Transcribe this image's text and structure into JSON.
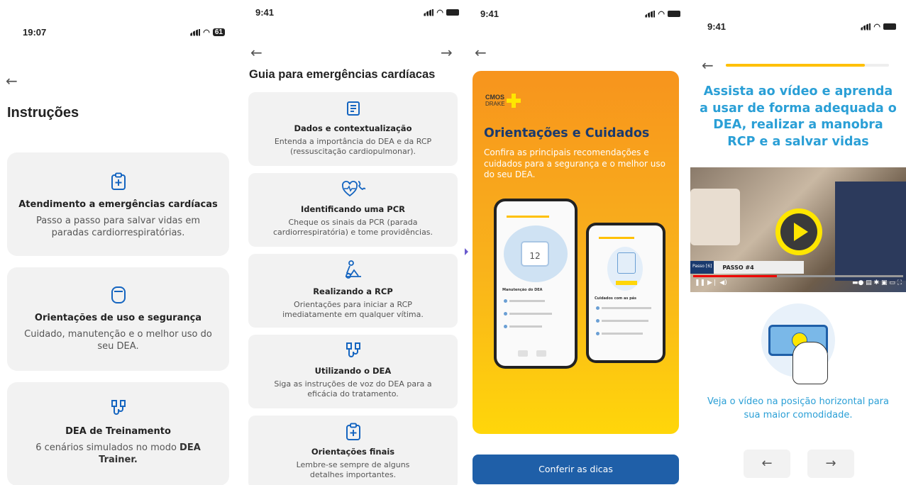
{
  "s1": {
    "time": "19:07",
    "battery": "61",
    "title": "Instruções",
    "cards": [
      {
        "icon": "clipboard-plus-icon",
        "title": "Atendimento a emergências cardíacas",
        "desc": "Passo a passo para salvar vidas em paradas cardiorrespiratórias."
      },
      {
        "icon": "device-icon",
        "title": "Orientações de uso e segurança",
        "desc": "Cuidado, manutenção e o melhor uso do seu DEA."
      },
      {
        "icon": "electrodes-icon",
        "title": "DEA de Treinamento",
        "desc_pre": "6 cenários simulados no modo ",
        "desc_bold": "DEA Trainer."
      }
    ]
  },
  "s2": {
    "time": "9:41",
    "title": "Guia para emergências cardíacas",
    "cards": [
      {
        "icon": "document-icon",
        "title": "Dados e contextualização",
        "desc": "Entenda a importância do DEA e da RCP (ressuscitação cardiopulmonar)."
      },
      {
        "icon": "heart-phone-icon",
        "title": "Identificando uma PCR",
        "desc": "Cheque os sinais da PCR (parada cardiorrespiratória) e tome providências."
      },
      {
        "icon": "cpr-icon",
        "title": "Realizando a RCP",
        "desc": "Orientações para iniciar a RCP imediatamente em qualquer vítima."
      },
      {
        "icon": "electrodes-icon",
        "title": "Utilizando o DEA",
        "desc": "Siga as instruções de voz do DEA para a eficácia do tratamento."
      },
      {
        "icon": "clipboard-plus-icon",
        "title": "Orientações finais",
        "desc": "Lembre-se sempre de alguns detalhes importantes."
      }
    ]
  },
  "s3": {
    "time": "9:41",
    "logo_top": "CMOS",
    "logo_bottom": "DRAKE",
    "title": "Orientações e Cuidados",
    "desc": "Confira as principais recomendações e cuidados para a segurança e o melhor uso do seu DEA.",
    "button": "Conferir as dicas",
    "phone_date": "12",
    "phone1_heading": "Manutenção do DEA",
    "phone2_heading": "Cuidados com as pás"
  },
  "s4": {
    "time": "9:41",
    "progress": 0.85,
    "title": "Assista ao vídeo e aprenda a usar de forma adequada o DEA, realizar a manobra RCP e a salvar vidas",
    "video_step_label": "Passo [6]",
    "video_step": "PASSO #4",
    "hint": "Veja o vídeo na posição horizontal para sua maior comodidade."
  },
  "colors": {
    "accent": "#1565c0",
    "orange": "#f7a21b",
    "yellow": "#ffd60a",
    "button": "#1f5fa8",
    "title_blue": "#2a9fd6"
  }
}
